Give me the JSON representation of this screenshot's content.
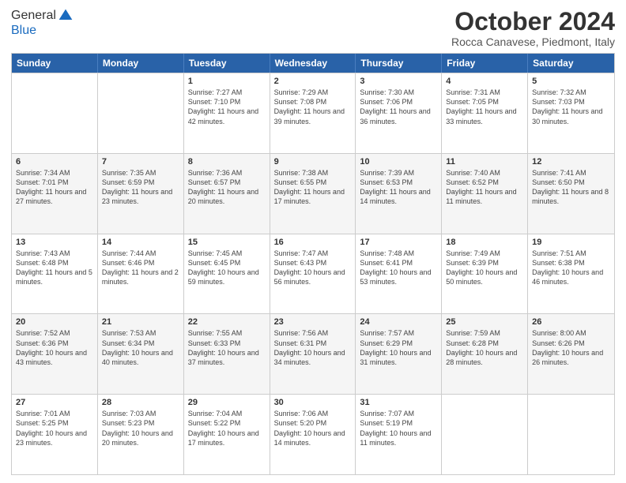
{
  "logo": {
    "line1": "General",
    "line2": "Blue"
  },
  "title": "October 2024",
  "subtitle": "Rocca Canavese, Piedmont, Italy",
  "header_days": [
    "Sunday",
    "Monday",
    "Tuesday",
    "Wednesday",
    "Thursday",
    "Friday",
    "Saturday"
  ],
  "weeks": [
    [
      {
        "day": "",
        "text": ""
      },
      {
        "day": "",
        "text": ""
      },
      {
        "day": "1",
        "text": "Sunrise: 7:27 AM\nSunset: 7:10 PM\nDaylight: 11 hours and 42 minutes."
      },
      {
        "day": "2",
        "text": "Sunrise: 7:29 AM\nSunset: 7:08 PM\nDaylight: 11 hours and 39 minutes."
      },
      {
        "day": "3",
        "text": "Sunrise: 7:30 AM\nSunset: 7:06 PM\nDaylight: 11 hours and 36 minutes."
      },
      {
        "day": "4",
        "text": "Sunrise: 7:31 AM\nSunset: 7:05 PM\nDaylight: 11 hours and 33 minutes."
      },
      {
        "day": "5",
        "text": "Sunrise: 7:32 AM\nSunset: 7:03 PM\nDaylight: 11 hours and 30 minutes."
      }
    ],
    [
      {
        "day": "6",
        "text": "Sunrise: 7:34 AM\nSunset: 7:01 PM\nDaylight: 11 hours and 27 minutes."
      },
      {
        "day": "7",
        "text": "Sunrise: 7:35 AM\nSunset: 6:59 PM\nDaylight: 11 hours and 23 minutes."
      },
      {
        "day": "8",
        "text": "Sunrise: 7:36 AM\nSunset: 6:57 PM\nDaylight: 11 hours and 20 minutes."
      },
      {
        "day": "9",
        "text": "Sunrise: 7:38 AM\nSunset: 6:55 PM\nDaylight: 11 hours and 17 minutes."
      },
      {
        "day": "10",
        "text": "Sunrise: 7:39 AM\nSunset: 6:53 PM\nDaylight: 11 hours and 14 minutes."
      },
      {
        "day": "11",
        "text": "Sunrise: 7:40 AM\nSunset: 6:52 PM\nDaylight: 11 hours and 11 minutes."
      },
      {
        "day": "12",
        "text": "Sunrise: 7:41 AM\nSunset: 6:50 PM\nDaylight: 11 hours and 8 minutes."
      }
    ],
    [
      {
        "day": "13",
        "text": "Sunrise: 7:43 AM\nSunset: 6:48 PM\nDaylight: 11 hours and 5 minutes."
      },
      {
        "day": "14",
        "text": "Sunrise: 7:44 AM\nSunset: 6:46 PM\nDaylight: 11 hours and 2 minutes."
      },
      {
        "day": "15",
        "text": "Sunrise: 7:45 AM\nSunset: 6:45 PM\nDaylight: 10 hours and 59 minutes."
      },
      {
        "day": "16",
        "text": "Sunrise: 7:47 AM\nSunset: 6:43 PM\nDaylight: 10 hours and 56 minutes."
      },
      {
        "day": "17",
        "text": "Sunrise: 7:48 AM\nSunset: 6:41 PM\nDaylight: 10 hours and 53 minutes."
      },
      {
        "day": "18",
        "text": "Sunrise: 7:49 AM\nSunset: 6:39 PM\nDaylight: 10 hours and 50 minutes."
      },
      {
        "day": "19",
        "text": "Sunrise: 7:51 AM\nSunset: 6:38 PM\nDaylight: 10 hours and 46 minutes."
      }
    ],
    [
      {
        "day": "20",
        "text": "Sunrise: 7:52 AM\nSunset: 6:36 PM\nDaylight: 10 hours and 43 minutes."
      },
      {
        "day": "21",
        "text": "Sunrise: 7:53 AM\nSunset: 6:34 PM\nDaylight: 10 hours and 40 minutes."
      },
      {
        "day": "22",
        "text": "Sunrise: 7:55 AM\nSunset: 6:33 PM\nDaylight: 10 hours and 37 minutes."
      },
      {
        "day": "23",
        "text": "Sunrise: 7:56 AM\nSunset: 6:31 PM\nDaylight: 10 hours and 34 minutes."
      },
      {
        "day": "24",
        "text": "Sunrise: 7:57 AM\nSunset: 6:29 PM\nDaylight: 10 hours and 31 minutes."
      },
      {
        "day": "25",
        "text": "Sunrise: 7:59 AM\nSunset: 6:28 PM\nDaylight: 10 hours and 28 minutes."
      },
      {
        "day": "26",
        "text": "Sunrise: 8:00 AM\nSunset: 6:26 PM\nDaylight: 10 hours and 26 minutes."
      }
    ],
    [
      {
        "day": "27",
        "text": "Sunrise: 7:01 AM\nSunset: 5:25 PM\nDaylight: 10 hours and 23 minutes."
      },
      {
        "day": "28",
        "text": "Sunrise: 7:03 AM\nSunset: 5:23 PM\nDaylight: 10 hours and 20 minutes."
      },
      {
        "day": "29",
        "text": "Sunrise: 7:04 AM\nSunset: 5:22 PM\nDaylight: 10 hours and 17 minutes."
      },
      {
        "day": "30",
        "text": "Sunrise: 7:06 AM\nSunset: 5:20 PM\nDaylight: 10 hours and 14 minutes."
      },
      {
        "day": "31",
        "text": "Sunrise: 7:07 AM\nSunset: 5:19 PM\nDaylight: 10 hours and 11 minutes."
      },
      {
        "day": "",
        "text": ""
      },
      {
        "day": "",
        "text": ""
      }
    ]
  ]
}
